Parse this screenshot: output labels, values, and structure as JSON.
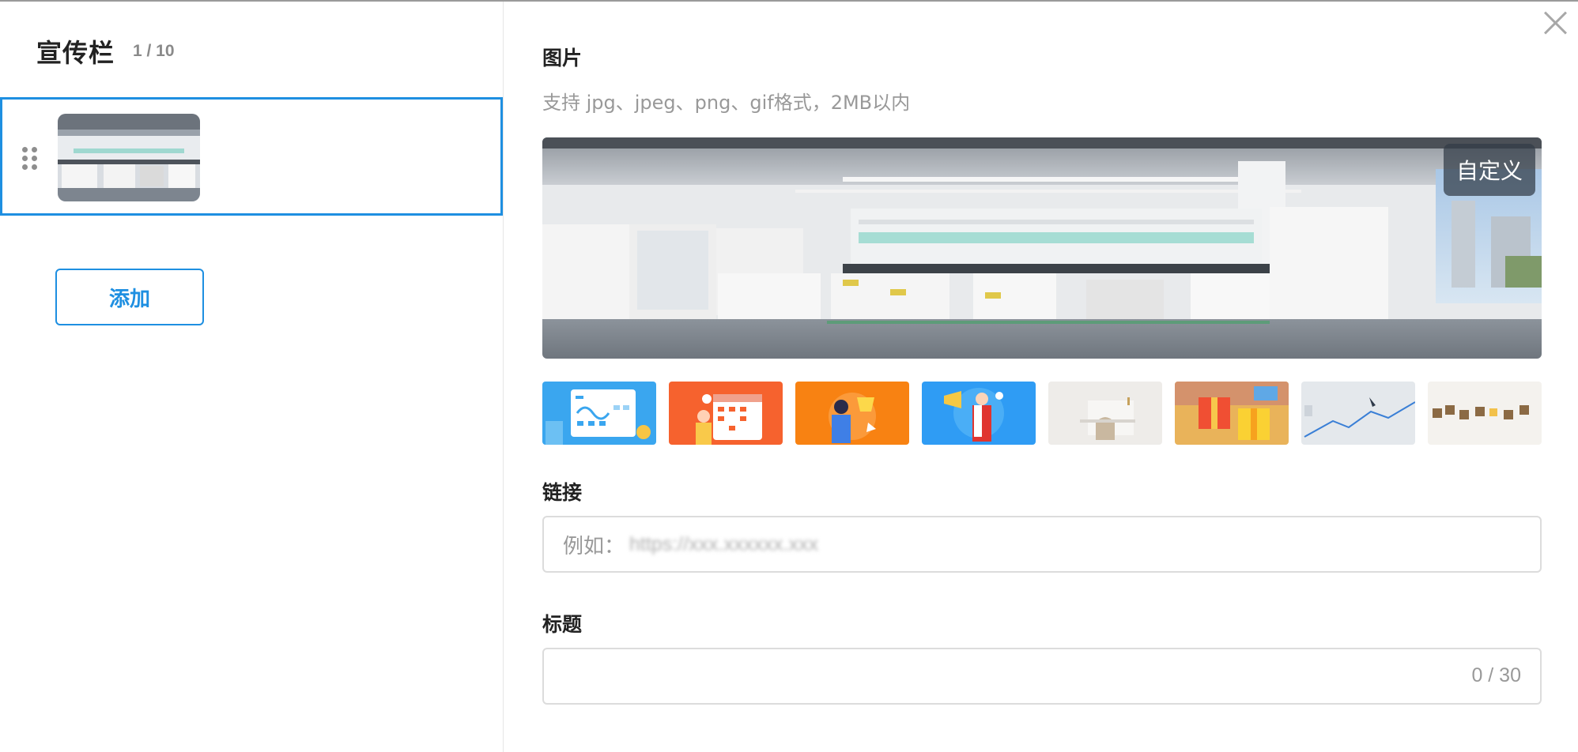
{
  "sidebar": {
    "title": "宣传栏",
    "count": "1 / 10",
    "add_label": "添加"
  },
  "image_section": {
    "label": "图片",
    "hint": "支持 jpg、jpeg、png、gif格式，2MB以内",
    "custom_label": "自定义",
    "presets": [
      {
        "name": "preset-dashboard-image",
        "theme": "blue"
      },
      {
        "name": "preset-calendar-image",
        "theme": "orange"
      },
      {
        "name": "preset-trophy-image",
        "theme": "orange"
      },
      {
        "name": "preset-megaphone-image",
        "theme": "blue"
      },
      {
        "name": "preset-desk-image",
        "theme": "light"
      },
      {
        "name": "preset-gift-image",
        "theme": "warm"
      },
      {
        "name": "preset-chart-image",
        "theme": "light"
      },
      {
        "name": "preset-blocks-image",
        "theme": "light"
      }
    ]
  },
  "link_section": {
    "label": "链接",
    "placeholder_prefix": "例如：",
    "placeholder_url": "https://xxx.xxxxxx.xxx"
  },
  "title_section": {
    "label": "标题",
    "counter": "0 / 30"
  },
  "colors": {
    "accent": "#1e8fe1",
    "border": "#dcdcdc",
    "muted_text": "#999999"
  }
}
